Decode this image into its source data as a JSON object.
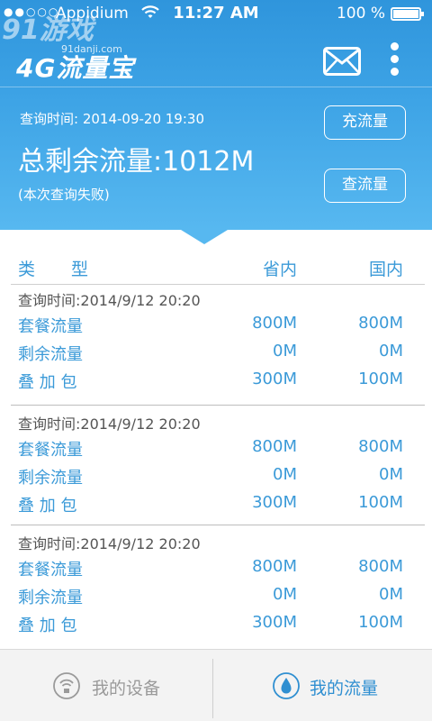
{
  "status_bar": {
    "carrier": "Appidium",
    "time": "11:27 AM",
    "battery": "100 %"
  },
  "watermark": {
    "logo": "91游戏",
    "site": "91danji.com"
  },
  "app": {
    "title": "4G流量宝"
  },
  "summary": {
    "query_time": "查询时间: 2014-09-20 19:30",
    "total_label": "总剩余流量:",
    "total_value": "1012M",
    "status": "(本次查询失败)"
  },
  "buttons": {
    "recharge": "充流量",
    "check": "查流量"
  },
  "table": {
    "headers": {
      "type": "类型",
      "province": "省内",
      "national": "国内"
    },
    "groups": [
      {
        "query_time": "查询时间:2014/9/12   20:20",
        "rows": [
          {
            "label": "套餐流量",
            "province": "800M",
            "national": "800M"
          },
          {
            "label": "剩余流量",
            "province": "0M",
            "national": "0M"
          },
          {
            "label": "叠 加 包",
            "province": "300M",
            "national": "100M"
          }
        ]
      },
      {
        "query_time": "查询时间:2014/9/12   20:20",
        "rows": [
          {
            "label": "套餐流量",
            "province": "800M",
            "national": "800M"
          },
          {
            "label": "剩余流量",
            "province": "0M",
            "national": "0M"
          },
          {
            "label": "叠 加 包",
            "province": "300M",
            "national": "100M"
          }
        ]
      },
      {
        "query_time": "查询时间:2014/9/12   20:20",
        "rows": [
          {
            "label": "套餐流量",
            "province": "800M",
            "national": "800M"
          },
          {
            "label": "剩余流量",
            "province": "0M",
            "national": "0M"
          },
          {
            "label": "叠 加 包",
            "province": "300M",
            "national": "100M"
          }
        ]
      }
    ]
  },
  "tabs": [
    {
      "label": "我的设备",
      "icon": "wifi-device-icon",
      "active": false
    },
    {
      "label": "我的流量",
      "icon": "water-drop-icon",
      "active": true
    }
  ],
  "colors": {
    "header_blue": "#3ea4e6",
    "accent_blue": "#3b9ad8",
    "inactive_gray": "#9a9a9a"
  }
}
